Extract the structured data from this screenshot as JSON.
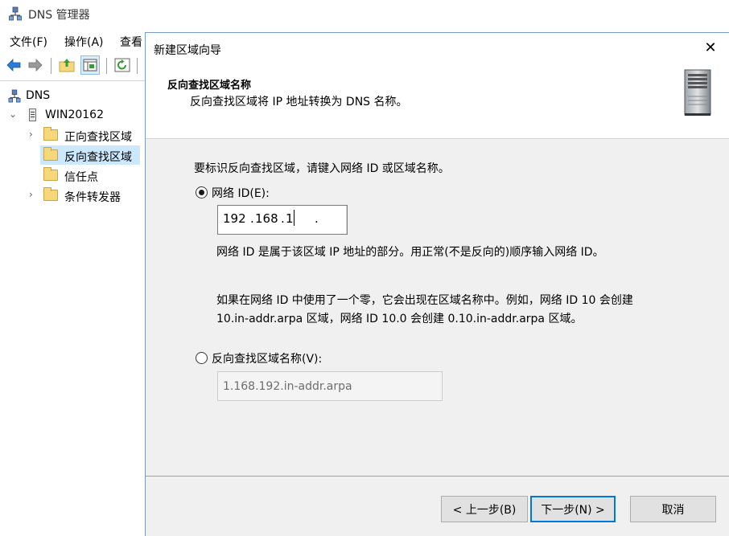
{
  "app": {
    "title": "DNS 管理器",
    "menu": [
      "文件(F)",
      "操作(A)",
      "查看"
    ]
  },
  "tree": {
    "root": "DNS",
    "server": "WIN20162",
    "items": [
      "正向查找区域",
      "反向查找区域",
      "信任点",
      "条件转发器"
    ],
    "selected_index": 1
  },
  "wizard": {
    "title": "新建区域向导",
    "close_glyph": "✕",
    "header_title": "反向查找区域名称",
    "header_subtitle": "反向查找区域将 IP 地址转换为 DNS 名称。",
    "instruction": "要标识反向查找区域，请键入网络 ID 或区域名称。",
    "option_network": {
      "label": "网络 ID(E):",
      "checked": true,
      "segments": [
        "192",
        "168",
        "1",
        ""
      ]
    },
    "help_line1": "网络 ID 是属于该区域 IP 地址的部分。用正常(不是反向的)顺序输入网络 ID。",
    "help_para": [
      "如果在网络 ID 中使用了一个零，它会出现在区域名称中。例如，网络 ID 10 会创建",
      "10.in-addr.arpa 区域，网络 ID 10.0 会创建 0.10.in-addr.arpa 区域。"
    ],
    "option_zone": {
      "label": "反向查找区域名称(V):",
      "checked": false,
      "value": "1.168.192.in-addr.arpa"
    },
    "buttons": {
      "back": "< 上一步(B)",
      "next": "下一步(N) >",
      "cancel": "取消"
    }
  },
  "colors": {
    "selection": "#cce8ff",
    "focus_border": "#0078d7",
    "dialog_bg": "#f0f0f0"
  }
}
